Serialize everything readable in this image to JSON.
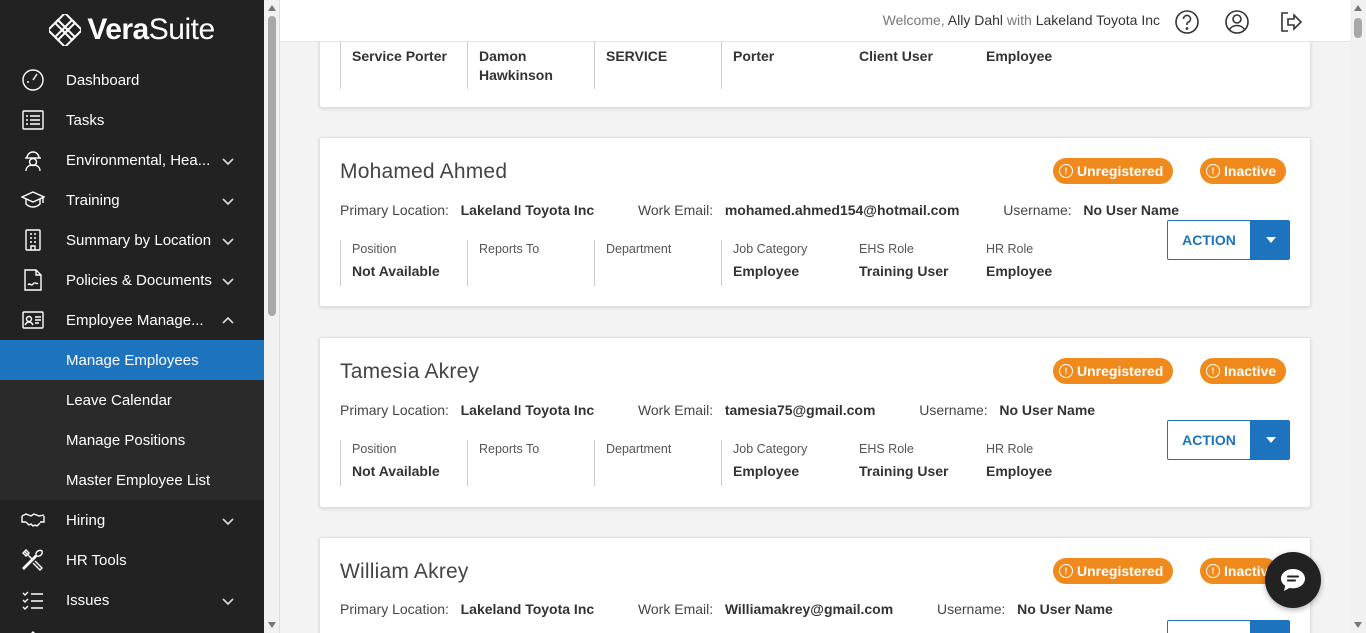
{
  "brand": {
    "logo_bold": "Vera",
    "logo_thin": "Suite"
  },
  "header": {
    "welcome_prefix": "Welcome,",
    "user": "Ally Dahl",
    "with": "with",
    "company": "Lakeland Toyota Inc"
  },
  "sidebar": {
    "items": [
      {
        "label": "Dashboard",
        "icon": "dashboard-gauge-icon"
      },
      {
        "label": "Tasks",
        "icon": "list-icon"
      },
      {
        "label": "Environmental, Hea...",
        "icon": "hardhat-worker-icon"
      },
      {
        "label": "Training",
        "icon": "graduation-cap-icon"
      },
      {
        "label": "Summary by Location",
        "icon": "building-icon"
      },
      {
        "label": "Policies & Documents",
        "icon": "document-sign-icon"
      },
      {
        "label": "Employee Manage...",
        "icon": "id-card-icon"
      },
      {
        "label": "Hiring",
        "icon": "handshake-icon"
      },
      {
        "label": "HR Tools",
        "icon": "tools-icon"
      },
      {
        "label": "Issues",
        "icon": "checklist-icon"
      }
    ],
    "sub_items": [
      "Manage Employees",
      "Leave Calendar",
      "Manage Positions",
      "Master Employee List"
    ]
  },
  "labels": {
    "primary_location": "Primary Location:",
    "work_email": "Work Email:",
    "username": "Username:",
    "position": "Position",
    "reports_to": "Reports To",
    "department": "Department",
    "job_category": "Job Category",
    "ehs_role": "EHS Role",
    "hr_role": "HR Role",
    "action": "ACTION",
    "unregistered": "Unregistered",
    "inactive": "Inactive"
  },
  "partial_card": {
    "position": "Service Porter",
    "reports_to": "Damon Hawkinson",
    "department": "SERVICE",
    "job_category": "Porter",
    "ehs_role": "Client User",
    "hr_role": "Employee"
  },
  "employees": [
    {
      "name": "Mohamed Ahmed",
      "primary_location": "Lakeland Toyota Inc",
      "work_email": "mohamed.ahmed154@hotmail.com",
      "username": "No User Name",
      "position": "Not Available",
      "reports_to": "",
      "department": "",
      "job_category": "Employee",
      "ehs_role": "Training User",
      "hr_role": "Employee"
    },
    {
      "name": "Tamesia Akrey",
      "primary_location": "Lakeland Toyota Inc",
      "work_email": "tamesia75@gmail.com",
      "username": "No User Name",
      "position": "Not Available",
      "reports_to": "",
      "department": "",
      "job_category": "Employee",
      "ehs_role": "Training User",
      "hr_role": "Employee"
    },
    {
      "name": "William Akrey",
      "primary_location": "Lakeland Toyota Inc",
      "work_email": "Williamakrey@gmail.com",
      "username": "No User Name",
      "badges": {
        "inactive": "Inactiv"
      }
    }
  ],
  "colors": {
    "sidebar_bg": "#222222",
    "active_bg": "#1e73be",
    "badge_orange": "#f08a1c",
    "accent_blue": "#1e73be"
  }
}
